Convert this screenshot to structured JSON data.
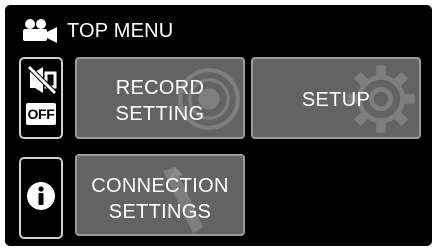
{
  "header": {
    "title": "TOP MENU",
    "icon": "video-camera-icon"
  },
  "side": {
    "audio_toggle": {
      "icon": "mute-icon",
      "badge": "OFF"
    },
    "info_button": {
      "icon": "info-icon"
    }
  },
  "tiles": [
    {
      "line1": "RECORD",
      "line2": "SETTING",
      "bg_icon": "record-icon"
    },
    {
      "line1": "SETUP",
      "bg_icon": "gear-icon"
    },
    {
      "line1": "CONNECTION",
      "line2": "SETTINGS",
      "bg_icon": "wrench-icon"
    }
  ],
  "colors": {
    "screen_bg": "#000000",
    "tile_bg": "#636363",
    "tile_border": "#9a9a9a",
    "text": "#ffffff"
  }
}
